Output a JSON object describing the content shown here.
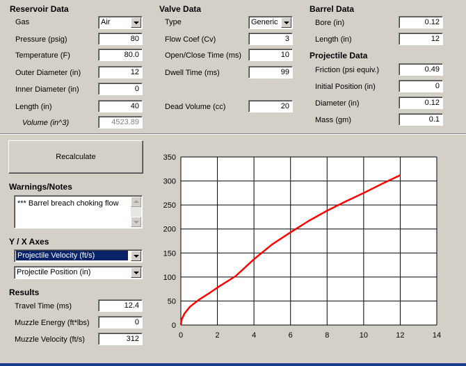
{
  "reservoir": {
    "title": "Reservoir Data",
    "gas": {
      "label": "Gas",
      "value": "Air"
    },
    "pressure": {
      "label": "Pressure (psig)",
      "value": "80"
    },
    "temperature": {
      "label": "Temperature (F)",
      "value": "80.0"
    },
    "outer_diameter": {
      "label": "Outer Diameter (in)",
      "value": "12"
    },
    "inner_diameter": {
      "label": "Inner Diameter (in)",
      "value": "0"
    },
    "length": {
      "label": "Length (in)",
      "value": "40"
    },
    "volume": {
      "label": "Volume (in^3)",
      "value": "4523.89"
    }
  },
  "valve": {
    "title": "Valve Data",
    "type": {
      "label": "Type",
      "value": "Generic"
    },
    "flow_coef": {
      "label": "Flow Coef (Cv)",
      "value": "3"
    },
    "open_close_time": {
      "label": "Open/Close Time (ms)",
      "value": "10"
    },
    "dwell_time": {
      "label": "Dwell Time (ms)",
      "value": "99"
    },
    "dead_volume": {
      "label": "Dead Volume (cc)",
      "value": "20"
    }
  },
  "barrel": {
    "title": "Barrel Data",
    "bore": {
      "label": "Bore (in)",
      "value": "0.12"
    },
    "length": {
      "label": "Length (in)",
      "value": "12"
    }
  },
  "projectile": {
    "title": "Projectile Data",
    "friction": {
      "label": "Friction (psi equiv.)",
      "value": "0.49"
    },
    "initial_position": {
      "label": "Initial Position (in)",
      "value": "0"
    },
    "diameter": {
      "label": "Diameter (in)",
      "value": "0.12"
    },
    "mass": {
      "label": "Mass (gm)",
      "value": "0.1"
    }
  },
  "recalculate_label": "Recalculate",
  "warnings": {
    "title": "Warnings/Notes",
    "text": "*** Barrel breach choking flow"
  },
  "axes": {
    "title": "Y / X Axes",
    "y_value": "Projectile Velocity (ft/s)",
    "x_value": "Projectile Position (in)"
  },
  "results": {
    "title": "Results",
    "travel_time": {
      "label": "Travel Time (ms)",
      "value": "12.4"
    },
    "muzzle_energy": {
      "label": "Muzzle Energy (ft*lbs)",
      "value": "0"
    },
    "muzzle_velocity": {
      "label": "Muzzle Velocity (ft/s)",
      "value": "312"
    }
  },
  "colors": {
    "series": "#ff0000",
    "grid": "#000000",
    "selection": "#0a246a"
  },
  "chart_data": {
    "type": "line",
    "title": "",
    "xlabel": "",
    "ylabel": "",
    "xlim": [
      0,
      14
    ],
    "ylim": [
      0,
      350
    ],
    "xticks": [
      "0",
      "2",
      "4",
      "6",
      "8",
      "10",
      "12",
      "14"
    ],
    "yticks": [
      "0",
      "50",
      "100",
      "150",
      "200",
      "250",
      "300",
      "350"
    ],
    "grid": true,
    "series": [
      {
        "x": [
          0,
          0.05,
          0.2,
          0.5,
          1,
          1.5,
          2,
          3,
          4,
          5,
          6,
          7,
          8,
          9,
          10,
          11,
          12
        ],
        "y": [
          0,
          12,
          24,
          38,
          53,
          65,
          78,
          102,
          137,
          168,
          193,
          217,
          238,
          257,
          275,
          294,
          312
        ]
      }
    ]
  }
}
